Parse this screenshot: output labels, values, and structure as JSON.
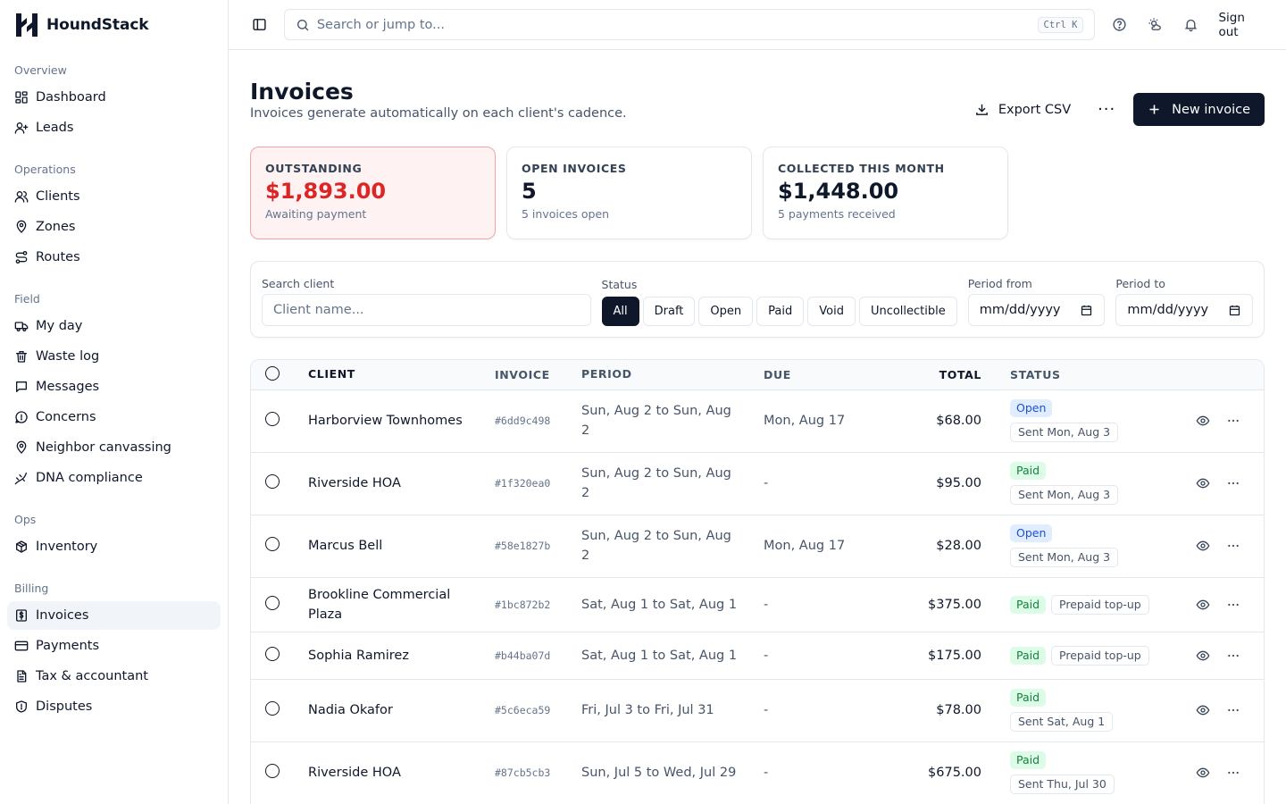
{
  "brand": {
    "name": "HoundStack"
  },
  "sidebar": {
    "groups": [
      {
        "label": "Overview",
        "items": [
          {
            "label": "Dashboard",
            "icon": "dashboard-icon"
          },
          {
            "label": "Leads",
            "icon": "user-plus-icon"
          }
        ]
      },
      {
        "label": "Operations",
        "items": [
          {
            "label": "Clients",
            "icon": "users-icon"
          },
          {
            "label": "Zones",
            "icon": "map-pin-icon"
          },
          {
            "label": "Routes",
            "icon": "route-icon"
          }
        ]
      },
      {
        "label": "Field",
        "items": [
          {
            "label": "My day",
            "icon": "truck-icon"
          },
          {
            "label": "Waste log",
            "icon": "trash-icon"
          },
          {
            "label": "Messages",
            "icon": "message-icon"
          },
          {
            "label": "Concerns",
            "icon": "alert-icon"
          },
          {
            "label": "Neighbor canvassing",
            "icon": "map-pin-icon"
          },
          {
            "label": "DNA compliance",
            "icon": "dna-icon"
          }
        ]
      },
      {
        "label": "Ops",
        "items": [
          {
            "label": "Inventory",
            "icon": "package-icon"
          }
        ]
      },
      {
        "label": "Billing",
        "items": [
          {
            "label": "Invoices",
            "icon": "invoice-icon",
            "active": true
          },
          {
            "label": "Payments",
            "icon": "credit-card-icon"
          },
          {
            "label": "Tax & accountant",
            "icon": "file-text-icon"
          },
          {
            "label": "Disputes",
            "icon": "shield-icon"
          }
        ]
      }
    ]
  },
  "topbar": {
    "search_placeholder": "Search or jump to...",
    "shortcut": "Ctrl K",
    "sign_out": "Sign out"
  },
  "page": {
    "title": "Invoices",
    "subtitle": "Invoices generate automatically on each client's cadence.",
    "export_label": "Export CSV",
    "more_label": "···",
    "new_label": "New invoice"
  },
  "stats": [
    {
      "label": "OUTSTANDING",
      "value": "$1,893.00",
      "sub": "Awaiting payment",
      "alert": true
    },
    {
      "label": "OPEN INVOICES",
      "value": "5",
      "sub": "5 invoices open",
      "alert": false
    },
    {
      "label": "COLLECTED THIS MONTH",
      "value": "$1,448.00",
      "sub": "5 payments received",
      "alert": false
    }
  ],
  "filters": {
    "search_label": "Search client",
    "search_placeholder": "Client name...",
    "status_label": "Status",
    "status_options": [
      "All",
      "Draft",
      "Open",
      "Paid",
      "Void",
      "Uncollectible"
    ],
    "status_selected": "All",
    "from_label": "Period from",
    "from_value": "mm/dd/yyyy",
    "to_label": "Period to",
    "to_value": "mm/dd/yyyy"
  },
  "table": {
    "headers": {
      "client": "CLIENT",
      "invoice": "INVOICE",
      "period": "PERIOD",
      "due": "DUE",
      "total": "TOTAL",
      "status": "STATUS"
    },
    "rows": [
      {
        "client": "Harborview Townhomes",
        "invoice": "#6dd9c498",
        "period": "Sun, Aug 2 to Sun, Aug 2",
        "due": "Mon, Aug 17",
        "total": "$68.00",
        "status": "Open",
        "status_kind": "open",
        "note": "Sent Mon, Aug 3",
        "stacked": true
      },
      {
        "client": "Riverside HOA",
        "invoice": "#1f320ea0",
        "period": "Sun, Aug 2 to Sun, Aug 2",
        "due": "-",
        "total": "$95.00",
        "status": "Paid",
        "status_kind": "paid",
        "note": "Sent Mon, Aug 3",
        "stacked": true
      },
      {
        "client": "Marcus Bell",
        "invoice": "#58e1827b",
        "period": "Sun, Aug 2 to Sun, Aug 2",
        "due": "Mon, Aug 17",
        "total": "$28.00",
        "status": "Open",
        "status_kind": "open",
        "note": "Sent Mon, Aug 3",
        "stacked": true
      },
      {
        "client": "Brookline Commercial Plaza",
        "invoice": "#1bc872b2",
        "period": "Sat, Aug 1 to Sat, Aug 1",
        "due": "-",
        "total": "$375.00",
        "status": "Paid",
        "status_kind": "paid",
        "note": "Prepaid top-up",
        "stacked": false
      },
      {
        "client": "Sophia Ramirez",
        "invoice": "#b44ba07d",
        "period": "Sat, Aug 1 to Sat, Aug 1",
        "due": "-",
        "total": "$175.00",
        "status": "Paid",
        "status_kind": "paid",
        "note": "Prepaid top-up",
        "stacked": false
      },
      {
        "client": "Nadia Okafor",
        "invoice": "#5c6eca59",
        "period": "Fri, Jul 3 to Fri, Jul 31",
        "due": "-",
        "total": "$78.00",
        "status": "Paid",
        "status_kind": "paid",
        "note": "Sent Sat, Aug 1",
        "stacked": true
      },
      {
        "client": "Riverside HOA",
        "invoice": "#87cb5cb3",
        "period": "Sun, Jul 5 to Wed, Jul 29",
        "due": "-",
        "total": "$675.00",
        "status": "Paid",
        "status_kind": "paid",
        "note": "Sent Thu, Jul 30",
        "stacked": true
      }
    ]
  },
  "colors": {
    "accent": "#0f172a",
    "alert": "#dc2626",
    "open_badge": "#1d4ed8",
    "paid_badge": "#15803d"
  }
}
